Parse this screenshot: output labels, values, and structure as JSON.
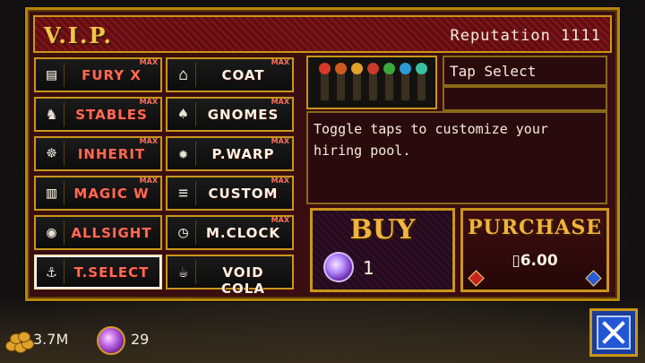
{
  "header": {
    "title": "V.I.P.",
    "reputation": "Reputation 1111"
  },
  "upgrades": [
    {
      "label": "FURY X",
      "icon": "fury-x-icon",
      "max": "MAX",
      "color": "#ff6a55"
    },
    {
      "label": "COAT",
      "icon": "coat-icon",
      "max": "MAX",
      "color": "#fbf4e4"
    },
    {
      "label": "STABLES",
      "icon": "horse-icon",
      "max": "MAX",
      "color": "#ff6a55"
    },
    {
      "label": "GNOMES",
      "icon": "gnome-icon",
      "max": "MAX",
      "color": "#fbf4e4"
    },
    {
      "label": "INHERIT",
      "icon": "inherit-icon",
      "max": "MAX",
      "color": "#ff6a55"
    },
    {
      "label": "P.WARP",
      "icon": "warp-icon",
      "max": "MAX",
      "color": "#fbf4e4"
    },
    {
      "label": "MAGIC W",
      "icon": "magic-w-icon",
      "max": "MAX",
      "color": "#ff6a55"
    },
    {
      "label": "CUSTOM",
      "icon": "sliders-icon",
      "max": "MAX",
      "color": "#fbf4e4"
    },
    {
      "label": "ALLSIGHT",
      "icon": "eye-icon",
      "max": "",
      "color": "#ff6a55"
    },
    {
      "label": "M.CLOCK",
      "icon": "clock-icon",
      "max": "MAX",
      "color": "#fbf4e4"
    },
    {
      "label": "T.SELECT",
      "icon": "tap-icon",
      "max": "",
      "color": "#ff6a55",
      "selected": true
    },
    {
      "label": "VOID COLA",
      "icon": "mug-icon",
      "max": "",
      "color": "#fbf4e4"
    }
  ],
  "detail": {
    "name": "Tap Select",
    "subtitle": "",
    "description": "Toggle taps to customize your hiring pool.",
    "tap_colors": [
      "#d83a2a",
      "#d05a1e",
      "#e0a22a",
      "#c83a2a",
      "#3aa83a",
      "#2a9ad8",
      "#3ac0a0"
    ]
  },
  "buy": {
    "label": "BUY",
    "gem_count": "1",
    "icon": "gem-icon"
  },
  "purchase": {
    "label": "PURCHASE",
    "price": "▯6.00"
  },
  "footer": {
    "gold": "3.7M",
    "gold_icon": "gold-pile-icon",
    "relics": "29",
    "relic_icon": "relic-gem-icon"
  },
  "close": {
    "icon": "close-icon"
  }
}
